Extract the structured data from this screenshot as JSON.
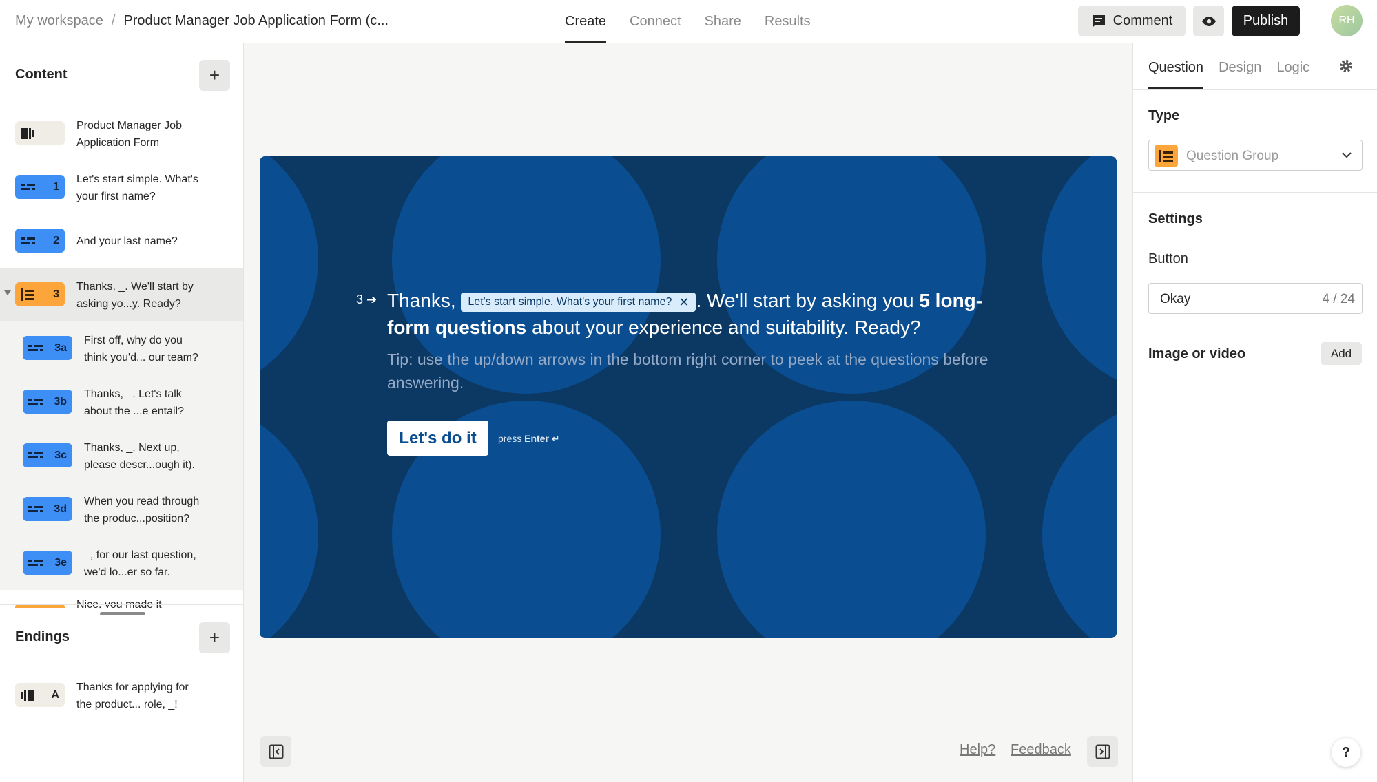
{
  "breadcrumb": {
    "workspace": "My workspace",
    "separator": "/",
    "title": "Product Manager Job Application Form (c..."
  },
  "top_tabs": [
    {
      "label": "Create",
      "active": true
    },
    {
      "label": "Connect",
      "active": false
    },
    {
      "label": "Share",
      "active": false
    },
    {
      "label": "Results",
      "active": false
    }
  ],
  "toolbar": {
    "comment_label": "Comment",
    "publish_label": "Publish",
    "avatar_initials": "RH"
  },
  "sidebar": {
    "content_title": "Content",
    "add_label": "+",
    "items": [
      {
        "badge": "",
        "line1": "Product Manager Job",
        "line2": "Application Form",
        "type": "welcome"
      },
      {
        "badge": "1",
        "line1": "Let's start simple. What's",
        "line2": "your first name?",
        "type": "short-text"
      },
      {
        "badge": "2",
        "line1": "And your last name?",
        "line2": "",
        "type": "short-text"
      },
      {
        "badge": "3",
        "line1": "Thanks, _. We'll start by",
        "line2": "asking yo...y. Ready?",
        "type": "question-group"
      },
      {
        "badge": "3a",
        "line1": "First off, why do you",
        "line2": "think you'd... our team?",
        "type": "long-text"
      },
      {
        "badge": "3b",
        "line1": "Thanks, _. Let's talk",
        "line2": "about the ...e entail?",
        "type": "long-text"
      },
      {
        "badge": "3c",
        "line1": "Thanks, _. Next up,",
        "line2": "please descr...ough it).",
        "type": "long-text"
      },
      {
        "badge": "3d",
        "line1": "When you read through",
        "line2": "the produc...position?",
        "type": "long-text"
      },
      {
        "badge": "3e",
        "line1": "_, for our last question,",
        "line2": "we'd lo...er so far.",
        "type": "long-text"
      }
    ],
    "cut_item_text": "Nice, you made it",
    "endings_title": "Endings",
    "endings": [
      {
        "badge": "A",
        "line1": "Thanks for applying for",
        "line2": "the product... role, _!"
      }
    ]
  },
  "canvas": {
    "question_number": "3",
    "text_before": "Thanks, ",
    "recall_label": "Let's start simple. What's your first name?",
    "text_after": ". We'll start by asking you ",
    "bold_text": "5 long-form questions",
    "text_end": " about your experience and suitability. Ready?",
    "tip": "Tip: use the up/down arrows in the bottom right corner to peek at the questions before answering.",
    "button_label": "Let's do it",
    "press_label": "press",
    "enter_label": "Enter ↵",
    "background_color": "#0c3864",
    "circle_color": "#0a4d90"
  },
  "footer": {
    "help_link": "Help?",
    "feedback_link": "Feedback"
  },
  "panel": {
    "tabs": [
      {
        "label": "Question",
        "active": true
      },
      {
        "label": "Design",
        "active": false
      },
      {
        "label": "Logic",
        "active": false
      }
    ],
    "type_label": "Type",
    "type_value": "Question Group",
    "settings_label": "Settings",
    "button_label": "Button",
    "button_value": "Okay",
    "button_count": "4 / 24",
    "media_label": "Image or video",
    "media_add": "Add"
  },
  "help_button": "?",
  "colors": {
    "accent_blue": "#3d8ef5",
    "accent_orange": "#fba53a",
    "publish": "#1c1c1c"
  }
}
